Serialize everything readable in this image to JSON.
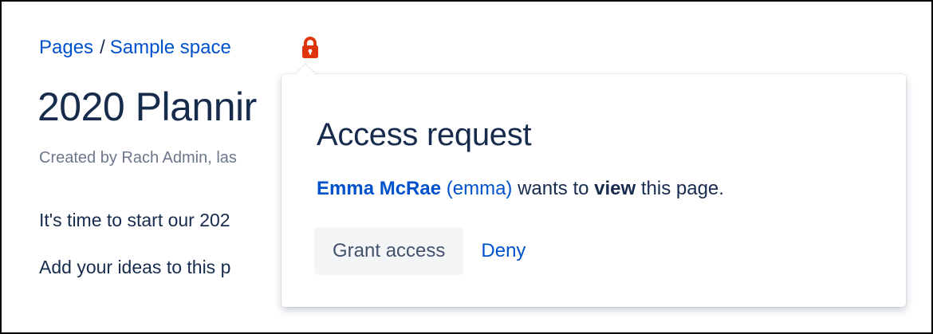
{
  "breadcrumb": {
    "items": [
      "Pages",
      "Sample space"
    ],
    "separator": "/"
  },
  "restriction_icon": {
    "icon": "lock-icon",
    "color": "#de350b"
  },
  "page": {
    "title": "2020 Plannir",
    "byline": "Created by Rach Admin, las",
    "paragraphs": [
      "It's time to start our 202",
      "Add your ideas to this p"
    ]
  },
  "access_request": {
    "title": "Access request",
    "user_name": "Emma McRae",
    "user_id": "(emma)",
    "wants_to": "wants to",
    "permission": "view",
    "suffix": "this page.",
    "grant_label": "Grant access",
    "deny_label": "Deny"
  },
  "colors": {
    "link": "#0052cc",
    "text": "#172b4d",
    "subtle_text": "#6b778c",
    "lock": "#de350b",
    "button_bg": "#f4f5f7"
  }
}
